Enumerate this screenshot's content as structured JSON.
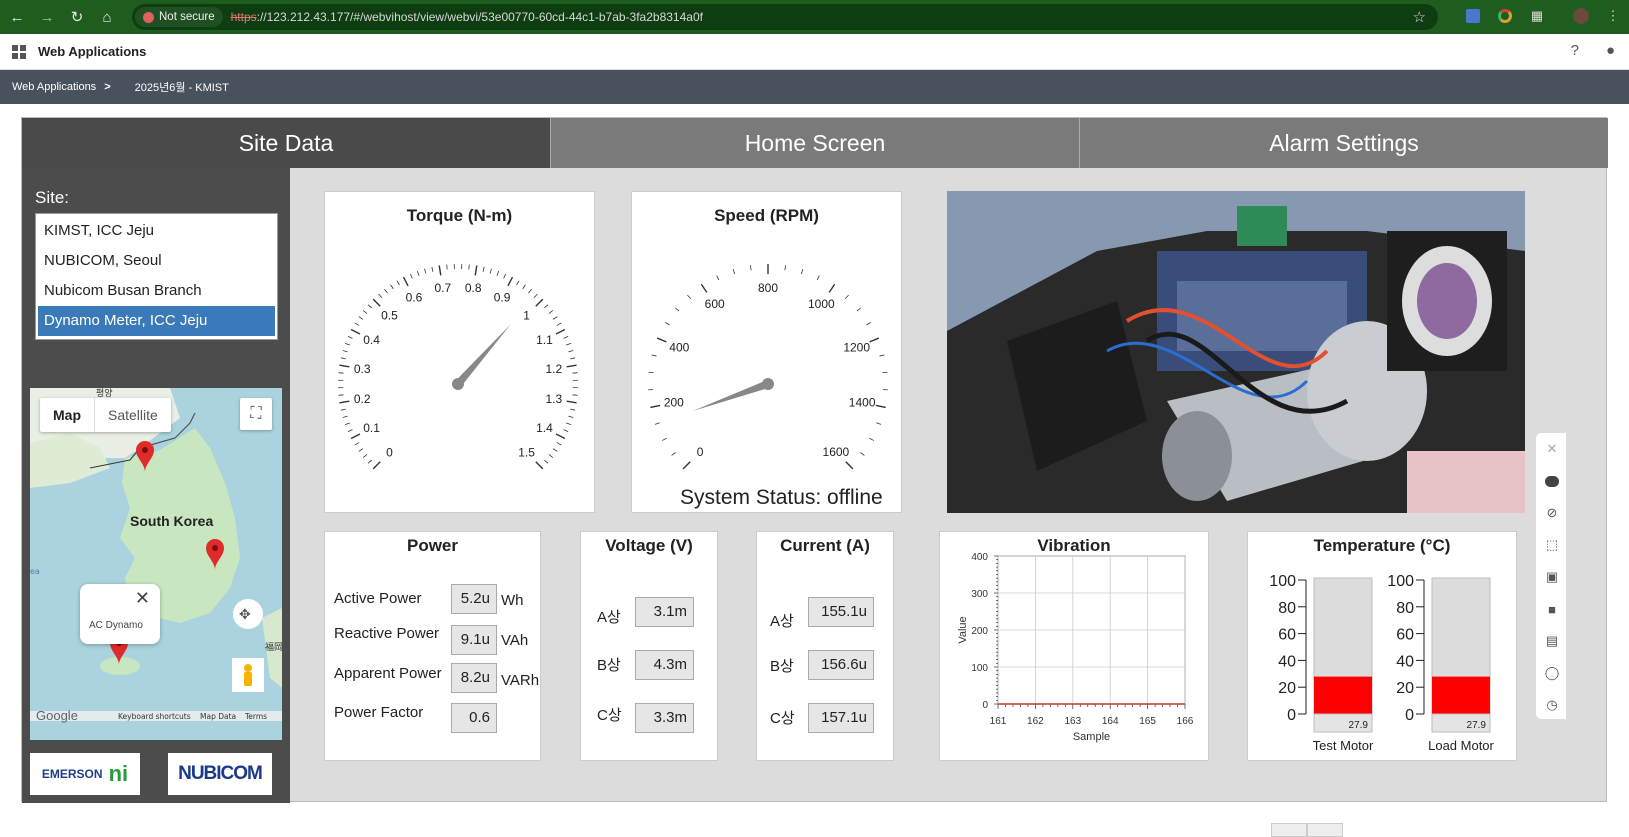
{
  "browser": {
    "not_secure": "Not secure",
    "url_proto": "https",
    "url_rest": "://123.212.43.177/#/webvihost/view/webvi/53e00770-60cd-44c1-b7ab-3fa2b8314a0f",
    "icons": [
      "back-icon",
      "forward-icon",
      "reload-icon",
      "home-icon",
      "star-icon",
      "translate-icon",
      "color-icon",
      "extensions-icon",
      "avatar-icon",
      "menu-icon"
    ]
  },
  "app": {
    "title": "Web Applications",
    "help": "?",
    "breadcrumb": {
      "root": "Web Applications",
      "separator": ">",
      "current": "2025년6월 - KMIST"
    }
  },
  "tabs": [
    "Site Data",
    "Home Screen",
    "Alarm Settings"
  ],
  "site": {
    "label": "Site:",
    "items": [
      "KIMST, ICC Jeju",
      "NUBICOM, Seoul",
      "Nubicom Busan Branch",
      "Dynamo Meter, ICC Jeju"
    ],
    "selected": 3
  },
  "map": {
    "tab_map": "Map",
    "tab_satellite": "Satellite",
    "country_label": "South Korea",
    "popup_text": "AC Dynamo",
    "google": "Google",
    "footer": [
      "Keyboard shortcuts",
      "Map Data",
      "Terms"
    ],
    "fragments": {
      "top": "평양",
      "west": "ea",
      "east": "福岡"
    }
  },
  "logos": {
    "emerson": "EMERSON",
    "ni": "ni",
    "nubicom": "NUBICOM"
  },
  "torque": {
    "title": "Torque (N-m)",
    "ticks": [
      "0",
      "0.1",
      "0.2",
      "0.3",
      "0.4",
      "0.5",
      "0.6",
      "0.7",
      "0.8",
      "0.9",
      "1",
      "1.1",
      "1.2",
      "1.3",
      "1.4",
      "1.5"
    ],
    "min": 0,
    "max": 1.5,
    "value": 0.98
  },
  "speed": {
    "title": "Speed (RPM)",
    "ticks": [
      "0",
      "200",
      "400",
      "600",
      "800",
      "1000",
      "1200",
      "1400",
      "1600"
    ],
    "min": 0,
    "max": 1600,
    "value": 150
  },
  "system_status": "System Status: offline",
  "power": {
    "title": "Power",
    "rows": [
      {
        "label": "Active Power",
        "value": "5.2u",
        "unit": "Wh"
      },
      {
        "label": "Reactive Power",
        "value": "9.1u",
        "unit": "VAh"
      },
      {
        "label": "Apparent Power",
        "value": "8.2u",
        "unit": "VARh"
      },
      {
        "label": "Power Factor",
        "value": "0.6",
        "unit": ""
      }
    ]
  },
  "voltage": {
    "title": "Voltage (V)",
    "rows": [
      {
        "label": "A상",
        "value": "3.1m"
      },
      {
        "label": "B상",
        "value": "4.3m"
      },
      {
        "label": "C상",
        "value": "3.3m"
      }
    ]
  },
  "current": {
    "title": "Current (A)",
    "rows": [
      {
        "label": "A상",
        "value": "155.1u"
      },
      {
        "label": "B상",
        "value": "156.6u"
      },
      {
        "label": "C상",
        "value": "157.1u"
      }
    ]
  },
  "vibration": {
    "title": "Vibration",
    "xlabel": "Sample",
    "ylabel": "Value"
  },
  "temperature": {
    "title": "Temperature (°C)",
    "ticks": [
      "100",
      "80",
      "60",
      "40",
      "20",
      "0"
    ],
    "motors": [
      {
        "name": "Test Motor",
        "value": 27.9,
        "value_text": "27.9"
      },
      {
        "name": "Load Motor",
        "value": 27.9,
        "value_text": "27.9"
      }
    ],
    "fill_color": "#ff0000"
  },
  "chart_data": {
    "type": "line",
    "title": "Vibration",
    "xlabel": "Sample",
    "ylabel": "Value",
    "x_ticks": [
      "161",
      "162",
      "163",
      "164",
      "165",
      "166"
    ],
    "y_ticks": [
      "0",
      "100",
      "200",
      "300",
      "400"
    ],
    "xlim": [
      161,
      166
    ],
    "ylim": [
      0,
      400
    ],
    "x": [
      161,
      162,
      163,
      164,
      165,
      166
    ],
    "values": [
      0,
      0,
      0,
      0,
      0,
      0
    ],
    "series_color": "#c0392b"
  }
}
